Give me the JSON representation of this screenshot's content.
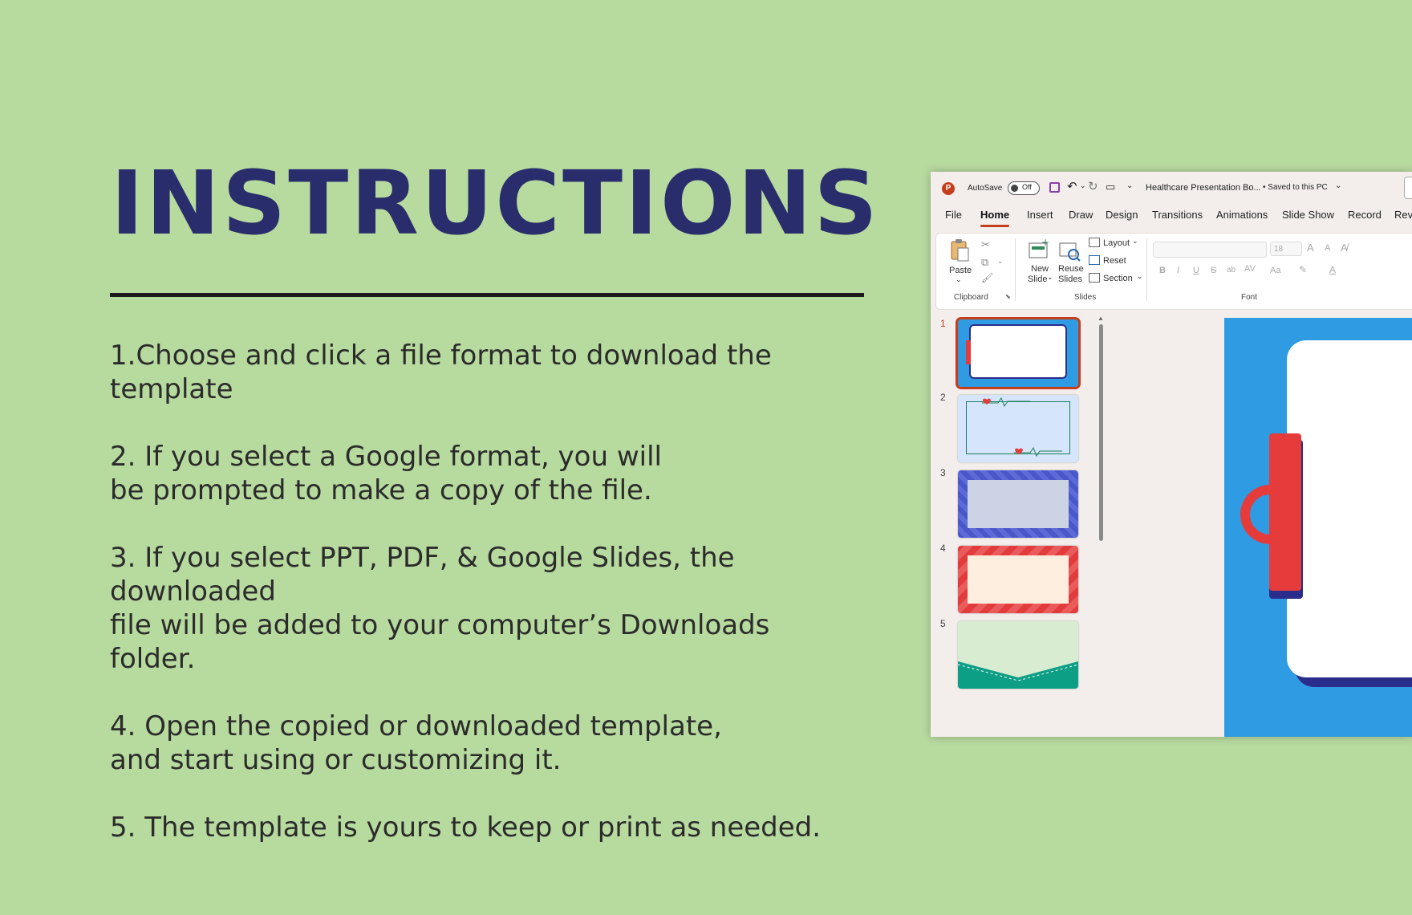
{
  "heading": "INSTRUCTIONS",
  "steps": [
    "1.Choose and click a file format to download the template",
    "2. If you select a Google format, you will\nbe prompted to make a copy of the file.",
    "3. If you select PPT, PDF, & Google Slides, the downloaded\nfile will be added to your computer’s Downloads folder.",
    "4. Open the copied or downloaded template,\nand start using or customizing it.",
    "5. The template is yours to keep or print as needed."
  ],
  "app": {
    "autosave_label": "AutoSave",
    "autosave_state": "Off",
    "doc_title": "Healthcare Presentation Bo...",
    "save_status": "• Saved to this PC",
    "tabs": [
      "File",
      "Home",
      "Insert",
      "Draw",
      "Design",
      "Transitions",
      "Animations",
      "Slide Show",
      "Record",
      "Rev"
    ],
    "active_tab": "Home",
    "ribbon": {
      "paste": "Paste",
      "clipboard": "Clipboard",
      "new_slide_1": "New",
      "new_slide_2": "Slide",
      "reuse_1": "Reuse",
      "reuse_2": "Slides",
      "layout": "Layout",
      "reset": "Reset",
      "section": "Section",
      "slides_group": "Slides",
      "font_size": "18",
      "font_group": "Font",
      "bold": "B",
      "italic": "I",
      "underline": "U",
      "strike": "S",
      "case": "Aa",
      "grow": "A",
      "shrink": "A"
    },
    "slide_numbers": [
      "1",
      "2",
      "3",
      "4",
      "5"
    ]
  },
  "colors": {
    "background": "#b7da9f",
    "heading": "#2a2d6b",
    "accent": "#c43e1c",
    "slide_blue": "#2e9be3",
    "clip_red": "#e63b3b"
  }
}
